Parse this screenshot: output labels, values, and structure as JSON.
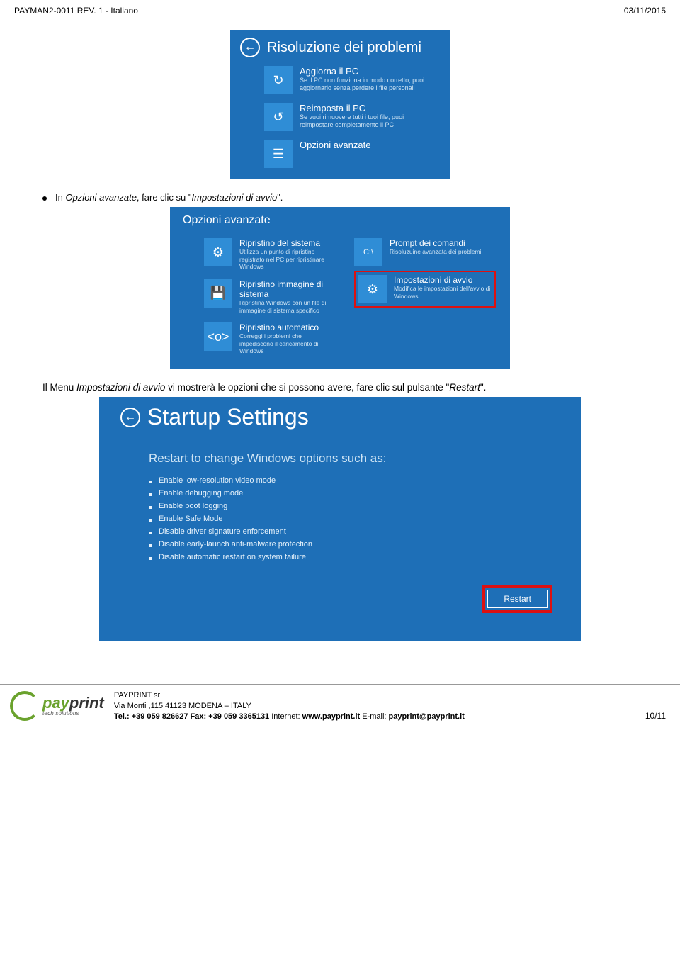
{
  "header": {
    "left": "PAYMAN2-0011  REV. 1 - Italiano",
    "right": "03/11/2015"
  },
  "bullet1": {
    "prefix": "In ",
    "italic": "Opzioni avanzate",
    "mid": ", fare clic su \"",
    "italic2": "Impostazioni di avvio",
    "suffix": "\"."
  },
  "screenshot1": {
    "title": "Risoluzione dei problemi",
    "options": [
      {
        "title": "Aggiorna il PC",
        "desc": "Se il PC non funziona in modo corretto, puoi aggiornarlo senza perdere i file personali"
      },
      {
        "title": "Reimposta il PC",
        "desc": "Se vuoi rimuovere tutti i tuoi file, puoi reimpostare completamente il PC"
      },
      {
        "title": "Opzioni avanzate",
        "desc": ""
      }
    ]
  },
  "screenshot2": {
    "title": "Opzioni avanzate",
    "left": [
      {
        "title": "Ripristino del sistema",
        "desc": "Utilizza un punto di ripristino registrato nel PC per ripristinare Windows"
      },
      {
        "title": "Ripristino immagine di sistema",
        "desc": "Ripristina Windows con un file di immagine di sistema specifico"
      },
      {
        "title": "Ripristino automatico",
        "desc": "Correggi i problemi che impediscono il caricamento di Windows"
      }
    ],
    "right": [
      {
        "title": "Prompt dei comandi",
        "desc": "Risoluzuine avanzata dei problemi"
      },
      {
        "title": "Impostazioni di avvio",
        "desc": "Modifica le impostazioni dell'avvio di Windows",
        "highlight": true
      }
    ]
  },
  "para2": {
    "prefix": "Il Menu ",
    "italic": "Impostazioni di avvio",
    "mid": " vi mostrerà le opzioni che si possono avere, fare clic sul pulsante \"",
    "italic2": "Restart",
    "suffix": "\"."
  },
  "screenshot3": {
    "title": "Startup Settings",
    "subtitle": "Restart to change Windows options such as:",
    "items": [
      "Enable low-resolution video mode",
      "Enable debugging mode",
      "Enable boot logging",
      "Enable Safe Mode",
      "Disable driver signature enforcement",
      "Disable early-launch anti-malware protection",
      "Disable automatic restart on system failure"
    ],
    "button": "Restart"
  },
  "footer": {
    "logo_main_a": "pay",
    "logo_main_b": "print",
    "logo_sub": "tech solutions",
    "company": "PAYPRINT srl",
    "address": "Via Monti ,115 41123 MODENA – ITALY",
    "tel_label": "Tel.: +39 059 826627  Fax: +39 059 3365131",
    "internet_label": " Internet: ",
    "internet": "www.payprint.it",
    "email_label": " E-mail: ",
    "email": "payprint@payprint.it",
    "page": "10/11"
  }
}
